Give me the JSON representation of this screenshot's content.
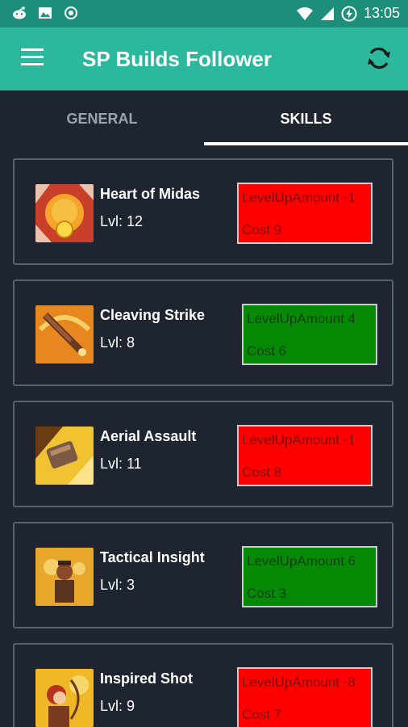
{
  "status_bar": {
    "time": "13:05"
  },
  "app": {
    "title": "SP Builds Follower"
  },
  "tabs": [
    {
      "label": "GENERAL",
      "selected": false
    },
    {
      "label": "SKILLS",
      "selected": true
    }
  ],
  "colors": {
    "app_bar": "#2bb89c",
    "status_bar": "#1d8e7a",
    "background": "#1e2430",
    "negative_box": "#ff0000",
    "positive_box": "#068a06"
  },
  "skills": [
    {
      "name": "Heart of Midas",
      "level": "Lvl: 12",
      "level_up": "LevelUpAmount -1",
      "cost": "Cost 9",
      "status": "negative",
      "icon": "midas-coin-icon"
    },
    {
      "name": "Cleaving Strike",
      "level": "Lvl: 8",
      "level_up": "LevelUpAmount 4",
      "cost": "Cost 6",
      "status": "positive",
      "icon": "sword-strike-icon"
    },
    {
      "name": "Aerial Assault",
      "level": "Lvl: 11",
      "level_up": "LevelUpAmount -1",
      "cost": "Cost 8",
      "status": "negative",
      "icon": "fist-assault-icon"
    },
    {
      "name": "Tactical Insight",
      "level": "Lvl: 3",
      "level_up": "LevelUpAmount 6",
      "cost": "Cost 3",
      "status": "positive",
      "icon": "commander-icon"
    },
    {
      "name": "Inspired Shot",
      "level": "Lvl: 9",
      "level_up": "LevelUpAmount -8",
      "cost": "Cost 7",
      "status": "negative",
      "icon": "archer-icon"
    }
  ]
}
